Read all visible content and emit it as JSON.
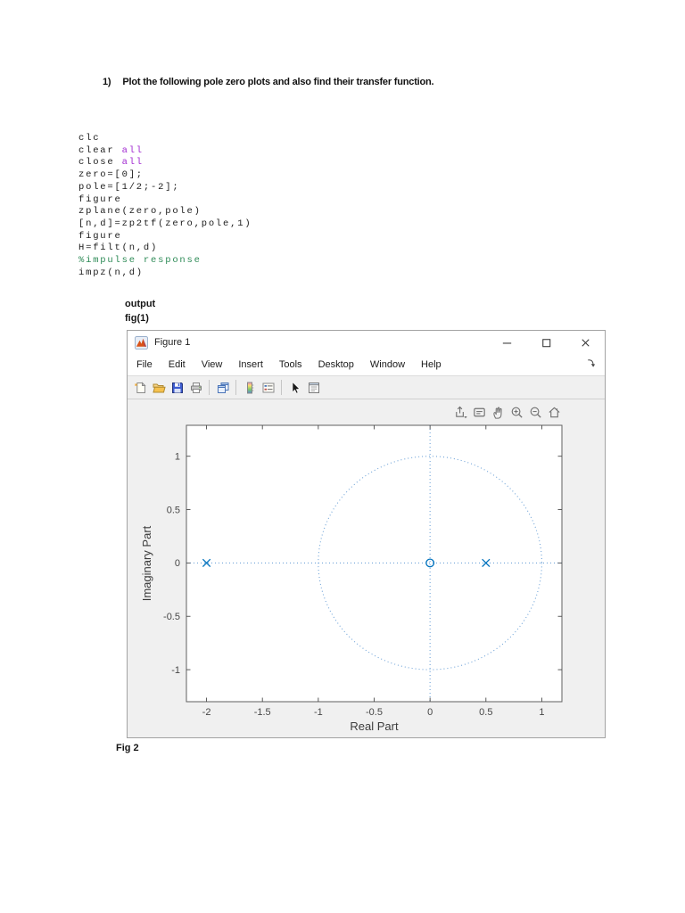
{
  "page": {
    "background": "#ffffff"
  },
  "document": {
    "question": {
      "number": "1)",
      "text": "Plot the following pole zero plots and also find their transfer function."
    },
    "code_lines": [
      [
        {
          "t": "clc",
          "c": "code"
        }
      ],
      [
        {
          "t": "clear ",
          "c": "code"
        },
        {
          "t": "all",
          "c": "keyword"
        }
      ],
      [
        {
          "t": "close ",
          "c": "code"
        },
        {
          "t": "all",
          "c": "keyword"
        }
      ],
      [
        {
          "t": "zero=[0];",
          "c": "code"
        }
      ],
      [
        {
          "t": "pole=[1/2;-2];",
          "c": "code"
        }
      ],
      [
        {
          "t": "figure",
          "c": "code"
        }
      ],
      [
        {
          "t": "zplane(zero,pole)",
          "c": "code"
        }
      ],
      [
        {
          "t": "[n,d]=zp2tf(zero,pole,1)",
          "c": "code"
        }
      ],
      [
        {
          "t": "figure",
          "c": "code"
        }
      ],
      [
        {
          "t": "H=filt(n,d)",
          "c": "code"
        }
      ],
      [
        {
          "t": "%impulse response",
          "c": "comment"
        }
      ],
      [
        {
          "t": "impz(n,d)",
          "c": "code"
        }
      ]
    ],
    "output_label": "output",
    "fig1_label": "fig(1)",
    "fig2_label": "Fig 2"
  },
  "figure_window": {
    "title": "Figure 1",
    "app_icon": "matlab-logo",
    "window_controls": [
      "minimize",
      "maximize",
      "close"
    ],
    "menu_items": [
      "File",
      "Edit",
      "View",
      "Insert",
      "Tools",
      "Desktop",
      "Window",
      "Help"
    ],
    "menu_overflow_icon": "dock-figure",
    "toolbar": [
      "new-figure",
      "open-file",
      "save-figure",
      "print-figure",
      "|",
      "link-plot",
      "|",
      "insert-colorbar",
      "insert-legend",
      "|",
      "edit-plot",
      "property-inspector"
    ],
    "axes_toolbar": [
      "export",
      "data-tips",
      "pan",
      "zoom-in",
      "zoom-out",
      "restore-view"
    ]
  },
  "colors": {
    "marker_blue": "#0072BD",
    "dotted_blue": "#6FA3D8",
    "keyword_purple": "#A22BD1",
    "comment_green": "#2E8B57",
    "window_chrome": "#F0F0F0",
    "plot_background": "#FFFFFF",
    "axes_box": "#5F5F5F"
  },
  "chart_data": {
    "type": "scatter",
    "title": "",
    "xlabel": "Real Part",
    "ylabel": "Imaginary Part",
    "xlim": [
      -2.18,
      1.18
    ],
    "ylim": [
      -1.3,
      1.29
    ],
    "xticks": [
      -2,
      -1.5,
      -1,
      -0.5,
      0,
      0.5,
      1
    ],
    "yticks": [
      -1,
      -0.5,
      0,
      0.5,
      1
    ],
    "grid": false,
    "legend": null,
    "unit_circle": {
      "center": [
        0,
        0
      ],
      "radius": 1,
      "style": "dotted"
    },
    "axis_lines": {
      "x_cross": 0,
      "y_cross": 0,
      "style": "dotted"
    },
    "series": [
      {
        "name": "zeros",
        "marker": "o",
        "color": "#0072BD",
        "points": [
          [
            0,
            0
          ]
        ]
      },
      {
        "name": "poles",
        "marker": "x",
        "color": "#0072BD",
        "points": [
          [
            -2,
            0
          ],
          [
            0.5,
            0
          ]
        ]
      }
    ]
  }
}
